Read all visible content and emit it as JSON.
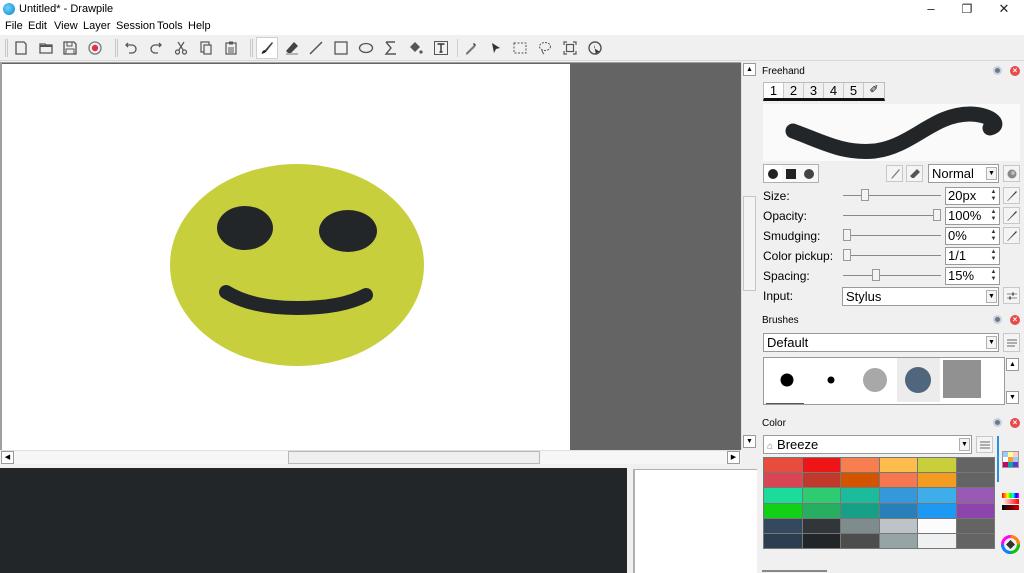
{
  "window": {
    "title": "Untitled* - Drawpile",
    "controls": {
      "minimize": "–",
      "maximize": "❐",
      "close": "✕"
    }
  },
  "menu": [
    "File",
    "Edit",
    "View",
    "Layer",
    "Session",
    "Tools",
    "Help"
  ],
  "toolbar": {
    "file_tools": [
      "new-document",
      "open-folder",
      "save",
      "record"
    ],
    "edit_tools": [
      "undo",
      "redo",
      "cut",
      "copy",
      "paste"
    ],
    "draw_tools": [
      "freehand-brush",
      "eraser",
      "line",
      "rectangle",
      "ellipse",
      "bezier",
      "fill",
      "text",
      "color-picker",
      "laser-pointer",
      "selection-rect",
      "selection-lasso",
      "zoom-fit",
      "inspector"
    ],
    "active_tool": "freehand-brush"
  },
  "canvas": {
    "face_color": "#c8cf3c",
    "feature_color": "#232629",
    "paper_color": "#ffffff",
    "background_color": "#646464"
  },
  "freehand": {
    "title": "Freehand",
    "preset_tabs": [
      "1",
      "2",
      "3",
      "4",
      "5",
      "✐"
    ],
    "active_preset": "1",
    "blend_mode": "Normal",
    "properties": [
      {
        "label": "Size:",
        "value": "20px",
        "slider_fraction": 0.2
      },
      {
        "label": "Opacity:",
        "value": "100%",
        "slider_fraction": 1.0
      },
      {
        "label": "Smudging:",
        "value": "0%",
        "slider_fraction": 0.0
      },
      {
        "label": "Color pickup:",
        "value": "1/1",
        "slider_fraction": 0.0
      },
      {
        "label": "Spacing:",
        "value": "15%",
        "slider_fraction": 0.32
      }
    ],
    "input_label": "Input:",
    "input_value": "Stylus"
  },
  "brushes": {
    "title": "Brushes",
    "preset_group": "Default"
  },
  "color": {
    "title": "Color",
    "palette_name": "Breeze",
    "lock_icon": "🔒",
    "swatches": [
      [
        "#e74c3c",
        "#ed1515",
        "#f67e4f",
        "#fdbc4b",
        "#c9ce3b",
        "#646464"
      ],
      [
        "#da4453",
        "#c0392b",
        "#d35400",
        "#f47750",
        "#f39c1f",
        "#646464"
      ],
      [
        "#1cdc9a",
        "#2ecc71",
        "#1abc9c",
        "#3498db",
        "#3daee9",
        "#9b59b6"
      ],
      [
        "#11d116",
        "#27ae60",
        "#16a085",
        "#2980b9",
        "#1d99f3",
        "#8e44ad"
      ],
      [
        "#34495e",
        "#31363b",
        "#7f8c8d",
        "#bdc3c7",
        "#fcfcfc",
        "#646464"
      ],
      [
        "#2c3e50",
        "#232629",
        "#4d4d4d",
        "#95a5a6",
        "#eff0f1",
        "#646464"
      ]
    ]
  }
}
